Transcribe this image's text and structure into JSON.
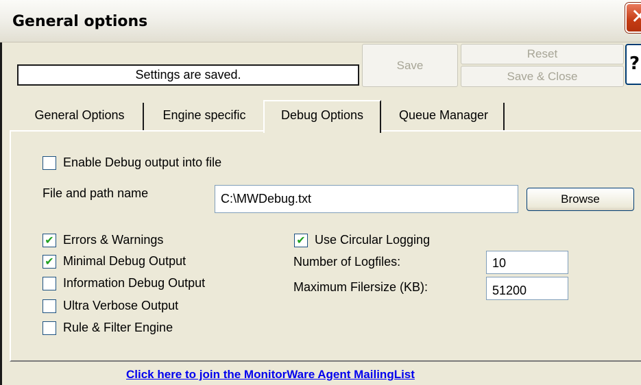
{
  "window": {
    "title": "General options",
    "close_glyph": "✕"
  },
  "status": {
    "text": "Settings are saved."
  },
  "toolbar": {
    "save_label": "Save",
    "reset_label": "Reset",
    "save_close_label": "Save & Close",
    "help_label": "?"
  },
  "tabs": [
    {
      "label": "General Options",
      "active": false
    },
    {
      "label": "Engine specific",
      "active": false
    },
    {
      "label": "Debug Options",
      "active": true
    },
    {
      "label": "Queue Manager",
      "active": false
    }
  ],
  "debug": {
    "enable_output": {
      "label": "Enable Debug output into file",
      "checked": false
    },
    "path_label": "File and path name",
    "path_value": "C:\\MWDebug.txt",
    "browse_label": "Browse",
    "options": [
      {
        "label": "Errors & Warnings",
        "checked": true
      },
      {
        "label": "Minimal Debug Output",
        "checked": true
      },
      {
        "label": "Information Debug Output",
        "checked": false
      },
      {
        "label": "Ultra Verbose Output",
        "checked": false
      },
      {
        "label": "Rule & Filter Engine",
        "checked": false
      }
    ],
    "circular": {
      "label": "Use Circular Logging",
      "checked": true
    },
    "logfiles_label": "Number of Logfiles:",
    "logfiles_value": "10",
    "filesize_label": "Maximum Filersize (KB):",
    "filesize_value": "51200"
  },
  "footer": {
    "link_text": "Click here to join the MonitorWare Agent MailingList"
  },
  "icons": {
    "check": "✔"
  },
  "colors": {
    "window_bg": "#ece9d8",
    "close_red": "#c43b13",
    "link_blue": "#0000ee",
    "check_green": "#21a121"
  }
}
